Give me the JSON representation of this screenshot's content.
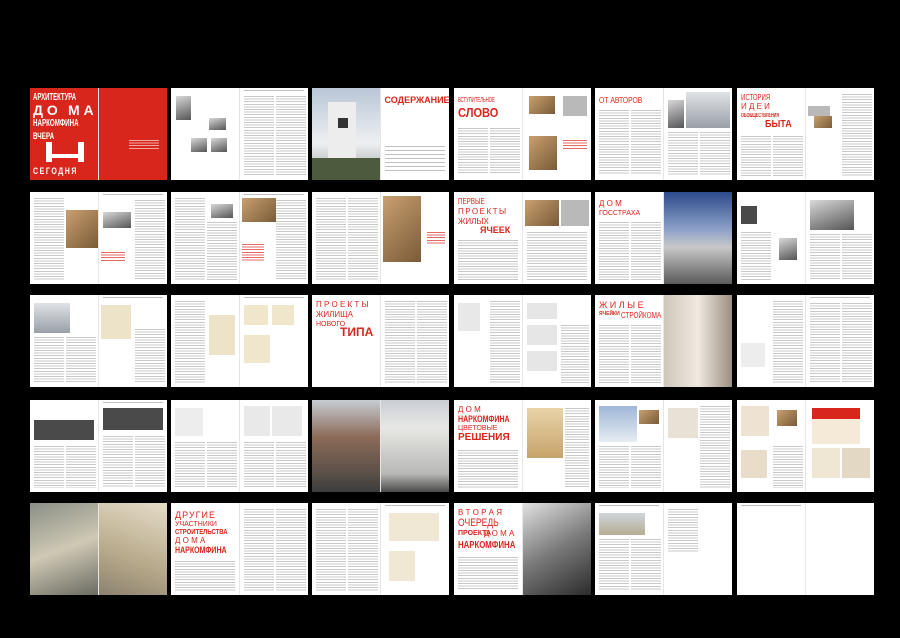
{
  "spreads": {
    "cover": {
      "title_line1": "АРХИТЕКТУРА",
      "letter_do": "Д  О",
      "letter_ma": "М  А",
      "title_line3": "НАРКОМФИНА",
      "word_vchera": "ВЧЕРА",
      "word_segodnya": "СЕГОДНЯ"
    },
    "contents": {
      "heading": "СОДЕРЖАНИЕ"
    },
    "intro": {
      "small": "ВСТУПИТЕЛЬНОЕ",
      "big": "СЛОВО"
    },
    "authors": {
      "heading": "ОТ АВТОРОВ"
    },
    "history": {
      "line1": "ИСТОРИЯ",
      "line2": "И Д Е И",
      "line3": "ОБОБЩЕСТВЛЕНИЯ",
      "line4": "БЫТА"
    },
    "first_projects": {
      "line1": "ПЕРВЫЕ",
      "line2": "ПРОЕКТЫ",
      "line3": "ЖИЛЫХ",
      "line4": "ЯЧЕЕК"
    },
    "gosstrakh": {
      "line1": "Д  О  М",
      "line2": "ГОССТРАХА"
    },
    "projects_new": {
      "line1": "П Р О Е К Т Ы",
      "line2": "ЖИЛИЩА",
      "line3": "НОВОГО",
      "line4": "ТИПА"
    },
    "stroykom": {
      "line1": "Ж И Л Ы Е",
      "line2": "ЯЧЕЙКИ",
      "line3": "СТРОЙКОМА"
    },
    "colors": {
      "line1": "Д  О  М",
      "line2": "НАРКОМФИНА",
      "line3": "ЦВЕТОВЫЕ",
      "line4": "РЕШЕНИЯ"
    },
    "others": {
      "line1": "ДРУГИЕ",
      "line2": "УЧАСТНИКИ",
      "line3": "СТРОИТЕЛЬСТВА",
      "line4": "Д  О  М  А",
      "line5": "НАРКОМФИНА"
    },
    "second_stage": {
      "line1": "В Т О Р А Я",
      "line2": "ОЧЕРЕДЬ",
      "line3": "ПРОЕКТА",
      "line4": "Д  О  М  А",
      "line5": "НАРКОМФИНА"
    }
  },
  "colors": {
    "accent_red": "#d9261c",
    "background": "#000000"
  }
}
